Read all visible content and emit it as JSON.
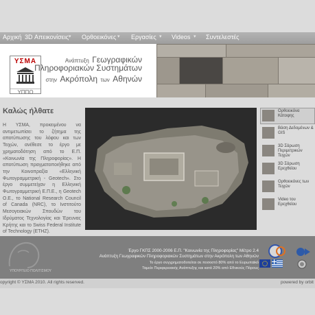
{
  "nav": {
    "items": [
      "Αρχική",
      "3D Απεικονίσεις",
      "Ορθοεικόνες",
      "Εργασίες",
      "Videos",
      "Συντελεστές"
    ]
  },
  "header": {
    "logo_top": "ΥΣΜΑ",
    "logo_bottom": "ΥΠΠΟ",
    "line1_small": "Ανάπτυξη",
    "line1_big": "Γεωγραφικών",
    "line2_big": "Πληροφοριακών Συστημάτων",
    "line3_small1": "στην",
    "line3_big": "Ακρόπολη",
    "line3_small2": "των",
    "line3_big2": "Αθηνών"
  },
  "main": {
    "welcome": "Καλώς ήλθατε",
    "intro": "Η ΥΣΜΑ, προκειμένου να αντιμετωπίσει το ζήτημα της αποτύπωσης του λόφου και των Τειχών, ανέθεσε το έργο με χρηματοδότηση από το Ε.Π. «Κοινωνία της Πληροφορίας». Η αποτύπωση πραγματοποιήθηκε από την Κοινοπραξία «Ελληνική Φωτογραμμετρική - Geotech». Στο έργο συμμετείχαν η Ελληνική Φωτογραμμετρική Ε.Π.Ε., η Geotech Ο.Ε., το National Research Council of Canada (NRC), το Ινστιτούτο Μεσογειακών Σπουδών του Ιδρύματος Τεχνολογίας και Έρευνας Κρήτης και το Swiss Federal Institute of Technology (ETHZ)."
  },
  "thumbs": [
    {
      "label": "Ορθοεικόνα Κάτοψης"
    },
    {
      "label": "Βάση Δεδομένων & GIS"
    },
    {
      "label": "3D Σάρωση Περιμετρικών Τειχών"
    },
    {
      "label": "3D Σάρωση Ερεχθείου"
    },
    {
      "label": "Ορθοεικόνες των Τειχών"
    },
    {
      "label": "Video του Ερεχθείου"
    }
  ],
  "footer": {
    "line1": "Έργο ΓΚΠΣ 2000-2006 Ε.Π. \"Κοινωνία της Πληροφορίας\" Μέτρο 2.4",
    "line2": "Ανάπτυξη Γεωγραφικών Πληροφοριακών Συστημάτων στην Ακρόπολη των Αθηνών",
    "line3": "Το έργο συγχρηματοδοτείται σε ποσοστό 80% από το Ευρωπαϊκό",
    "line4": "Ταμείο Περιφερειακής Ανάπτυξης και κατά 20% από Εθνικούς Πόρους",
    "copyright": "opyright © ΥΣΜΑ 2010.  All rights reserved.",
    "powered": "powered by orbit",
    "ghost": "ΥΠΟΥΡΓΕΙΟ ΠΟΛΙΤΙΣΜΟΥ"
  },
  "colors": {
    "nav_bg": "#a8a8a8",
    "footer_bg": "#7f7f7f",
    "page_bg": "#dcdcdc",
    "logo_red": "#b00000"
  }
}
